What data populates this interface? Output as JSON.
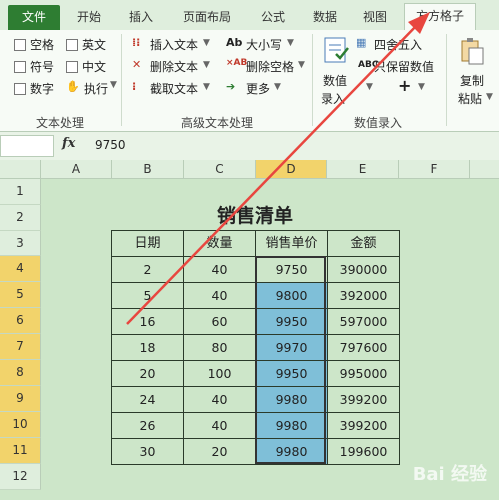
{
  "tabs": [
    "文件",
    "开始",
    "插入",
    "页面布局",
    "公式",
    "数据",
    "视图",
    "方方格子"
  ],
  "ribbon": {
    "text_group": {
      "checkboxes": [
        "空格",
        "英文",
        "符号",
        "中文",
        "数字"
      ],
      "execute_label": "执行",
      "label": "文本处理"
    },
    "advanced_group": {
      "items": [
        "插入文本",
        "删除文本",
        "截取文本",
        "大小写",
        "删除空格",
        "更多"
      ],
      "label": "高级文本处理"
    },
    "number_group": {
      "input_label_1": "数值",
      "input_label_2": "录入",
      "round_label": "四舍五入",
      "keep_label": "只保留数值",
      "plus_label": "+",
      "label": "数值录入"
    },
    "copy_group": {
      "label_1": "复制",
      "label_2": "粘贴"
    }
  },
  "formula_bar": {
    "fx": "fx",
    "value": "9750"
  },
  "columns": [
    "A",
    "B",
    "C",
    "D",
    "E",
    "F"
  ],
  "rows": [
    "1",
    "2",
    "3",
    "4",
    "5",
    "6",
    "7",
    "8",
    "9",
    "10",
    "11",
    "12"
  ],
  "sheet": {
    "title": "销售清单",
    "headers": [
      "日期",
      "数量",
      "销售单价",
      "金额"
    ],
    "data": [
      [
        "2",
        "40",
        "9750",
        "390000"
      ],
      [
        "5",
        "40",
        "9800",
        "392000"
      ],
      [
        "16",
        "60",
        "9950",
        "597000"
      ],
      [
        "18",
        "80",
        "9970",
        "797600"
      ],
      [
        "20",
        "100",
        "9950",
        "995000"
      ],
      [
        "24",
        "40",
        "9980",
        "399200"
      ],
      [
        "26",
        "40",
        "9980",
        "399200"
      ],
      [
        "30",
        "20",
        "9980",
        "199600"
      ]
    ]
  },
  "watermark": "Bai 经验",
  "colors": {
    "accent": "#e8463f",
    "selected_header": "#f2d36b",
    "highlight": "#7fbfd8",
    "sheet_bg": "#cde6c9"
  }
}
